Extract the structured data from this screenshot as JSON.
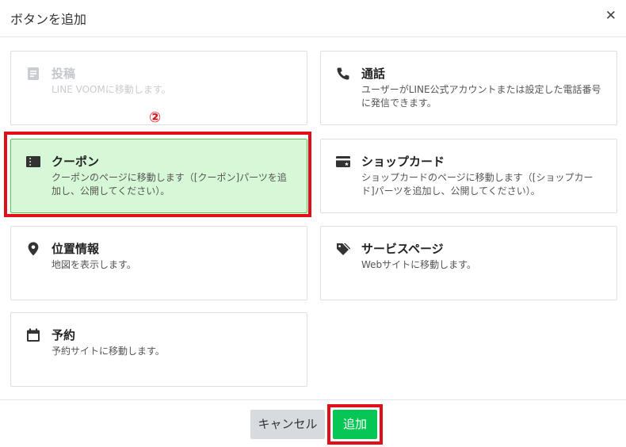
{
  "dialog": {
    "title": "ボタンを追加"
  },
  "cards": [
    {
      "name": "投稿",
      "desc": "LINE VOOMに移動します。",
      "icon": "document-icon",
      "state": "disabled"
    },
    {
      "name": "通話",
      "desc": "ユーザーがLINE公式アカウントまたは設定した電話番号に発信できます。",
      "icon": "phone-icon",
      "state": "normal"
    },
    {
      "name": "クーポン",
      "desc": "クーポンのページに移動します（[クーポン]パーツを追加し、公開してください）。",
      "icon": "coupon-icon",
      "state": "selected"
    },
    {
      "name": "ショップカード",
      "desc": "ショップカードのページに移動します（[ショップカード]パーツを追加し、公開してください）。",
      "icon": "shop-card-icon",
      "state": "normal"
    },
    {
      "name": "位置情報",
      "desc": "地図を表示します。",
      "icon": "location-pin-icon",
      "state": "normal"
    },
    {
      "name": "サービスページ",
      "desc": "Webサイトに移動します。",
      "icon": "tag-icon",
      "state": "normal"
    },
    {
      "name": "予約",
      "desc": "予約サイトに移動します。",
      "icon": "calendar-icon",
      "state": "normal"
    }
  ],
  "annotation": {
    "step": "②",
    "color": "#e0101a"
  },
  "footer": {
    "cancel_label": "キャンセル",
    "add_label": "追加"
  },
  "colors": {
    "accent_green": "#06c755",
    "selected_bg": "#d6f8d6",
    "highlight_red": "#e0101a"
  }
}
